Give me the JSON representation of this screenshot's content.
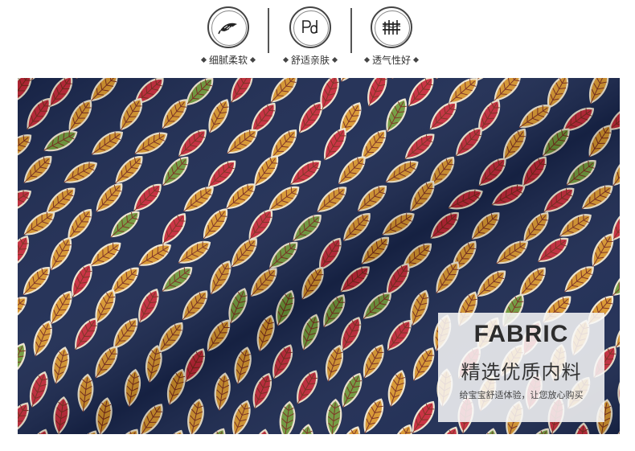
{
  "features": [
    {
      "label": "细腻柔软",
      "icon": "feather-icon"
    },
    {
      "label": "舒适亲肤",
      "icon": "pd-letters-icon"
    },
    {
      "label": "透气性好",
      "icon": "fence-icon"
    }
  ],
  "fabric_panel": {
    "title_en": "FABRIC",
    "title_zh": "精选优质内料",
    "subtitle": "给宝宝舒适体验，让您放心购买"
  },
  "colors": {
    "fabric_background": "#1a2850",
    "leaf_red": "#c8283a",
    "leaf_orange": "#d9962c",
    "leaf_green": "#6f9a3a",
    "leaf_outline": "#f0e6d0"
  }
}
